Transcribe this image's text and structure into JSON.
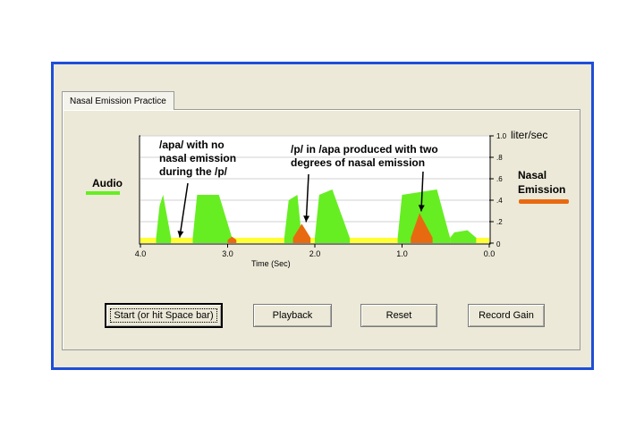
{
  "tab": {
    "label": "Nasal Emission Practice"
  },
  "chart_data": {
    "type": "area",
    "xlabel": "Time (Sec)",
    "x_ticks": [
      "4.0",
      "3.0",
      "2.0",
      "1.0",
      "0.0"
    ],
    "xlim": [
      4.0,
      0.0
    ],
    "y_ticks": [
      ".2",
      ".4",
      ".6",
      ".8",
      "1.0"
    ],
    "y_zero": "0",
    "y_unit": "liter/sec",
    "ylim": [
      0,
      1.0
    ],
    "series": [
      {
        "name": "Audio",
        "color": "#66ee22",
        "segments": [
          {
            "x": [
              3.82,
              3.78,
              3.74,
              3.65
            ],
            "y": [
              0.05,
              0.35,
              0.45,
              0.05
            ]
          },
          {
            "x": [
              3.4,
              3.35,
              3.1,
              2.95
            ],
            "y": [
              0.05,
              0.45,
              0.45,
              0.05
            ]
          },
          {
            "x": [
              2.35,
              2.3,
              2.2,
              2.15
            ],
            "y": [
              0.05,
              0.4,
              0.45,
              0.05
            ]
          },
          {
            "x": [
              2.0,
              1.95,
              1.8,
              1.6
            ],
            "y": [
              0.05,
              0.45,
              0.5,
              0.05
            ]
          },
          {
            "x": [
              1.05,
              1.0,
              0.6,
              0.45
            ],
            "y": [
              0.05,
              0.45,
              0.5,
              0.05
            ]
          },
          {
            "x": [
              0.45,
              0.4,
              0.25,
              0.15
            ],
            "y": [
              0.05,
              0.1,
              0.12,
              0.05
            ]
          }
        ]
      },
      {
        "name": "Nasal Emission",
        "color": "#e86a10",
        "segments": [
          {
            "x": [
              3.0,
              2.95,
              2.9
            ],
            "y": [
              0.03,
              0.06,
              0.03
            ]
          },
          {
            "x": [
              2.25,
              2.15,
              2.05
            ],
            "y": [
              0.05,
              0.18,
              0.05
            ]
          },
          {
            "x": [
              0.9,
              0.8,
              0.65
            ],
            "y": [
              0.05,
              0.28,
              0.05
            ]
          }
        ]
      }
    ],
    "legend": {
      "audio": "Audio",
      "nasal_line1": "Nasal",
      "nasal_line2": "Emission"
    },
    "annotations": [
      {
        "lines": [
          "/apa/ with no",
          "nasal emission",
          "during the /p/"
        ],
        "target_x": 3.55,
        "target_y": 0.02
      },
      {
        "lines": [
          "/p/ in /apa produced with two",
          "degrees of nasal emission"
        ],
        "targets": [
          {
            "x": 2.1,
            "y": 0.18
          },
          {
            "x": 0.78,
            "y": 0.28
          }
        ]
      }
    ]
  },
  "buttons": {
    "start": "Start (or hit Space bar)",
    "playback": "Playback",
    "reset": "Reset",
    "record_gain": "Record Gain"
  }
}
